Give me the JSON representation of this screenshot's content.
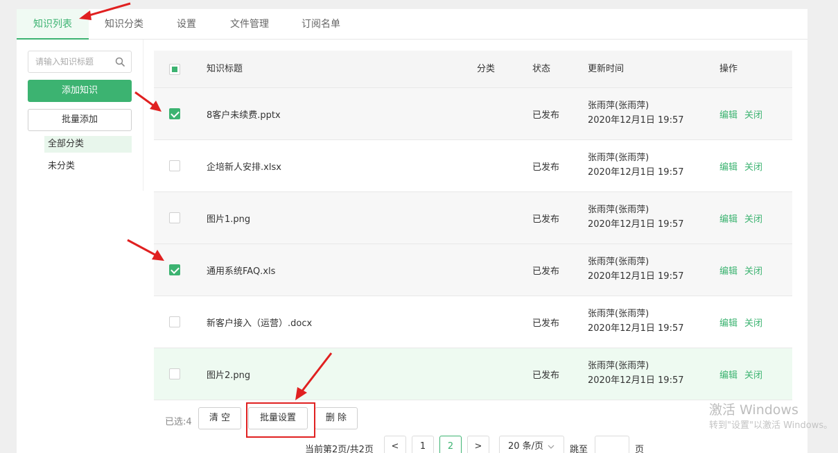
{
  "tabs": [
    {
      "label": "知识列表",
      "active": true
    },
    {
      "label": "知识分类",
      "active": false
    },
    {
      "label": "设置",
      "active": false
    },
    {
      "label": "文件管理",
      "active": false
    },
    {
      "label": "订阅名单",
      "active": false
    }
  ],
  "sidebar": {
    "search_placeholder": "请输入知识标题",
    "search_icon": "search-icon",
    "add_button": "添加知识",
    "batch_add_button": "批量添加",
    "categories": [
      {
        "label": "全部分类",
        "active": true
      },
      {
        "label": "未分类",
        "active": false
      }
    ]
  },
  "table": {
    "headers": {
      "title": "知识标题",
      "category": "分类",
      "status": "状态",
      "updated": "更新时间",
      "actions": "操作"
    },
    "header_checkbox": "partial",
    "rows": [
      {
        "checked": true,
        "title": "8客户未续费.pptx",
        "category": "",
        "status": "已发布",
        "author": "张雨萍(张雨萍)",
        "time": "2020年12月1日 19:57",
        "edit": "编辑",
        "close": "关闭"
      },
      {
        "checked": false,
        "title": "企培新人安排.xlsx",
        "category": "",
        "status": "已发布",
        "author": "张雨萍(张雨萍)",
        "time": "2020年12月1日 19:57",
        "edit": "编辑",
        "close": "关闭"
      },
      {
        "checked": false,
        "title": "图片1.png",
        "category": "",
        "status": "已发布",
        "author": "张雨萍(张雨萍)",
        "time": "2020年12月1日 19:57",
        "edit": "编辑",
        "close": "关闭"
      },
      {
        "checked": true,
        "title": "通用系统FAQ.xls",
        "category": "",
        "status": "已发布",
        "author": "张雨萍(张雨萍)",
        "time": "2020年12月1日 19:57",
        "edit": "编辑",
        "close": "关闭"
      },
      {
        "checked": false,
        "title": "新客户接入（运营）.docx",
        "category": "",
        "status": "已发布",
        "author": "张雨萍(张雨萍)",
        "time": "2020年12月1日 19:57",
        "edit": "编辑",
        "close": "关闭"
      },
      {
        "checked": false,
        "title": "图片2.png",
        "category": "",
        "status": "已发布",
        "author": "张雨萍(张雨萍)",
        "time": "2020年12月1日 19:57",
        "edit": "编辑",
        "close": "关闭"
      }
    ]
  },
  "footer": {
    "selected_label": "已选:4",
    "clear_button": "清 空",
    "batch_settings_button": "批量设置",
    "delete_button": "删 除"
  },
  "pagination": {
    "summary": "当前第2页/共2页",
    "prev": "<",
    "pages": [
      "1",
      "2"
    ],
    "current_page": "2",
    "next": ">",
    "page_size": "20 条/页",
    "jump_label": "跳至",
    "page_suffix": "页"
  },
  "watermark": {
    "line1": "激活 Windows",
    "line2": "转到\"设置\"以激活 Windows。"
  },
  "colors": {
    "accent": "#3cb371",
    "annotation": "#e02020"
  }
}
